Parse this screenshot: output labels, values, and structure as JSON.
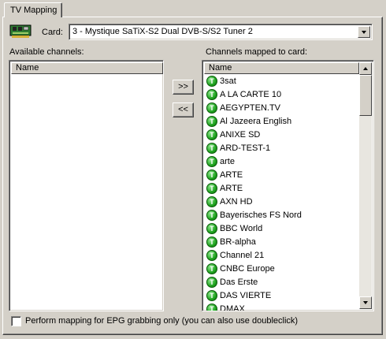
{
  "tab": {
    "label": "TV Mapping"
  },
  "card": {
    "label": "Card:",
    "selected": "3 - Mystique SaTiX-S2 Dual DVB-S/S2 Tuner 2"
  },
  "available": {
    "label": "Available channels:",
    "column": "Name",
    "items": []
  },
  "buttons": {
    "map": ">>",
    "unmap": "<<"
  },
  "mapped": {
    "label": "Channels mapped to card:",
    "column": "Name",
    "icon_letter": "T",
    "items": [
      "3sat",
      "A LA CARTE 10",
      "AEGYPTEN.TV",
      "Al Jazeera English",
      "ANIXE SD",
      "ARD-TEST-1",
      "arte",
      "ARTE",
      "ARTE",
      "AXN HD",
      "Bayerisches FS Nord",
      "BBC World",
      "BR-alpha",
      "Channel 21",
      "CNBC Europe",
      "Das Erste",
      "DAS VIERTE",
      "DMAX"
    ]
  },
  "epg_option": {
    "label": "Perform mapping for EPG grabbing only (you can also use doubleclick)",
    "checked": false
  }
}
